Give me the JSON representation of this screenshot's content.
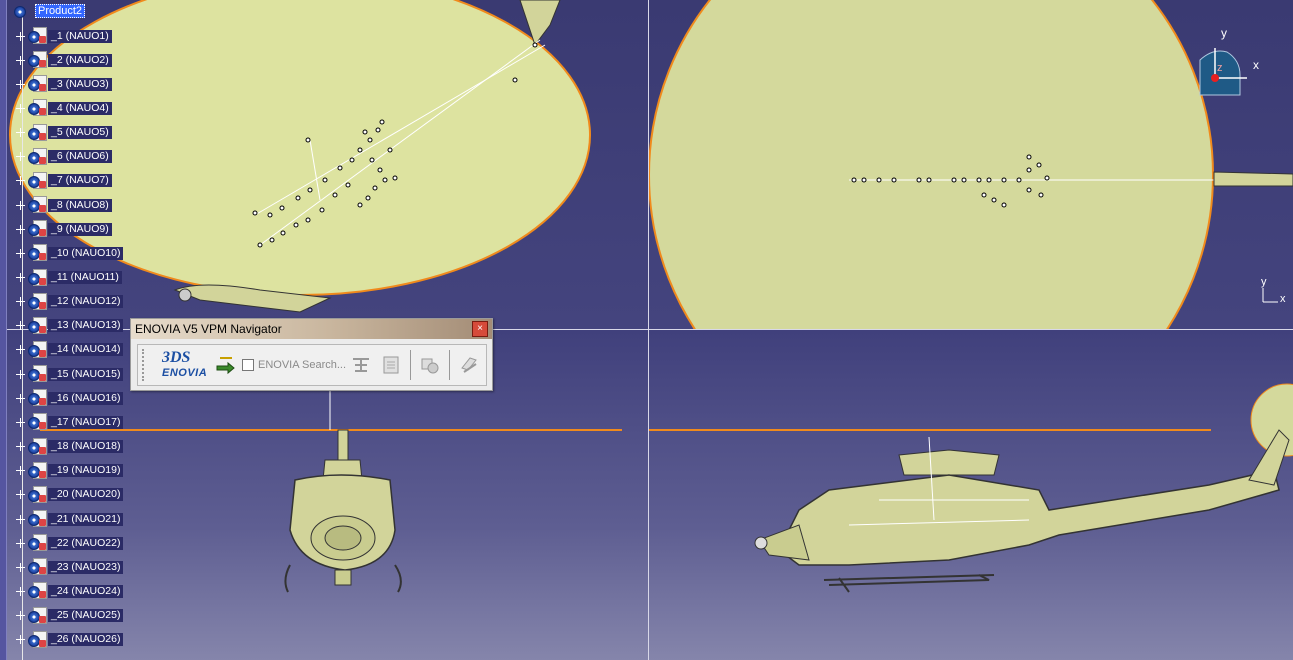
{
  "tree": {
    "root": "Product2",
    "items": [
      {
        "label": "_1 (NAUO1)"
      },
      {
        "label": "_2 (NAUO2)"
      },
      {
        "label": "_3 (NAUO3)"
      },
      {
        "label": "_4 (NAUO4)"
      },
      {
        "label": "_5 (NAUO5)"
      },
      {
        "label": "_6 (NAUO6)"
      },
      {
        "label": "_7 (NAUO7)"
      },
      {
        "label": "_8 (NAUO8)"
      },
      {
        "label": "_9 (NAUO9)"
      },
      {
        "label": "_10 (NAUO10)"
      },
      {
        "label": "_11 (NAUO11)"
      },
      {
        "label": "_12 (NAUO12)"
      },
      {
        "label": "_13 (NAUO13)"
      },
      {
        "label": "_14 (NAUO14)"
      },
      {
        "label": "_15 (NAUO15)"
      },
      {
        "label": "_16 (NAUO16)"
      },
      {
        "label": "_17 (NAUO17)"
      },
      {
        "label": "_18 (NAUO18)"
      },
      {
        "label": "_19 (NAUO19)"
      },
      {
        "label": "_20 (NAUO20)"
      },
      {
        "label": "_21 (NAUO21)"
      },
      {
        "label": "_22 (NAUO22)"
      },
      {
        "label": "_23 (NAUO23)"
      },
      {
        "label": "_24 (NAUO24)"
      },
      {
        "label": "_25 (NAUO25)"
      },
      {
        "label": "_26 (NAUO26)"
      }
    ]
  },
  "toolbar": {
    "title": "ENOVIA V5 VPM Navigator",
    "close": "×",
    "logo_ds": "3DS",
    "logo_text": "ENOVIA",
    "search_label": "ENOVIA Search..."
  },
  "compass": {
    "x": "x",
    "y": "y",
    "z": "z"
  },
  "mini_axis": {
    "x": "x",
    "y": "y"
  },
  "colors": {
    "viewport_bg": "#3f3f7a",
    "disk_fill": "#dde3a0",
    "disk_edge": "#f08a1c",
    "selection": "#3366ff"
  }
}
